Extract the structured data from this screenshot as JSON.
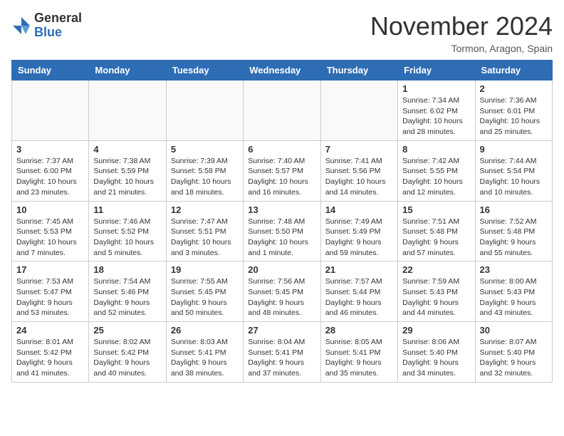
{
  "header": {
    "logo_general": "General",
    "logo_blue": "Blue",
    "month_year": "November 2024",
    "location": "Tormon, Aragon, Spain"
  },
  "weekdays": [
    "Sunday",
    "Monday",
    "Tuesday",
    "Wednesday",
    "Thursday",
    "Friday",
    "Saturday"
  ],
  "weeks": [
    [
      {
        "day": "",
        "detail": ""
      },
      {
        "day": "",
        "detail": ""
      },
      {
        "day": "",
        "detail": ""
      },
      {
        "day": "",
        "detail": ""
      },
      {
        "day": "",
        "detail": ""
      },
      {
        "day": "1",
        "detail": "Sunrise: 7:34 AM\nSunset: 6:02 PM\nDaylight: 10 hours and 28 minutes."
      },
      {
        "day": "2",
        "detail": "Sunrise: 7:36 AM\nSunset: 6:01 PM\nDaylight: 10 hours and 25 minutes."
      }
    ],
    [
      {
        "day": "3",
        "detail": "Sunrise: 7:37 AM\nSunset: 6:00 PM\nDaylight: 10 hours and 23 minutes."
      },
      {
        "day": "4",
        "detail": "Sunrise: 7:38 AM\nSunset: 5:59 PM\nDaylight: 10 hours and 21 minutes."
      },
      {
        "day": "5",
        "detail": "Sunrise: 7:39 AM\nSunset: 5:58 PM\nDaylight: 10 hours and 18 minutes."
      },
      {
        "day": "6",
        "detail": "Sunrise: 7:40 AM\nSunset: 5:57 PM\nDaylight: 10 hours and 16 minutes."
      },
      {
        "day": "7",
        "detail": "Sunrise: 7:41 AM\nSunset: 5:56 PM\nDaylight: 10 hours and 14 minutes."
      },
      {
        "day": "8",
        "detail": "Sunrise: 7:42 AM\nSunset: 5:55 PM\nDaylight: 10 hours and 12 minutes."
      },
      {
        "day": "9",
        "detail": "Sunrise: 7:44 AM\nSunset: 5:54 PM\nDaylight: 10 hours and 10 minutes."
      }
    ],
    [
      {
        "day": "10",
        "detail": "Sunrise: 7:45 AM\nSunset: 5:53 PM\nDaylight: 10 hours and 7 minutes."
      },
      {
        "day": "11",
        "detail": "Sunrise: 7:46 AM\nSunset: 5:52 PM\nDaylight: 10 hours and 5 minutes."
      },
      {
        "day": "12",
        "detail": "Sunrise: 7:47 AM\nSunset: 5:51 PM\nDaylight: 10 hours and 3 minutes."
      },
      {
        "day": "13",
        "detail": "Sunrise: 7:48 AM\nSunset: 5:50 PM\nDaylight: 10 hours and 1 minute."
      },
      {
        "day": "14",
        "detail": "Sunrise: 7:49 AM\nSunset: 5:49 PM\nDaylight: 9 hours and 59 minutes."
      },
      {
        "day": "15",
        "detail": "Sunrise: 7:51 AM\nSunset: 5:48 PM\nDaylight: 9 hours and 57 minutes."
      },
      {
        "day": "16",
        "detail": "Sunrise: 7:52 AM\nSunset: 5:48 PM\nDaylight: 9 hours and 55 minutes."
      }
    ],
    [
      {
        "day": "17",
        "detail": "Sunrise: 7:53 AM\nSunset: 5:47 PM\nDaylight: 9 hours and 53 minutes."
      },
      {
        "day": "18",
        "detail": "Sunrise: 7:54 AM\nSunset: 5:46 PM\nDaylight: 9 hours and 52 minutes."
      },
      {
        "day": "19",
        "detail": "Sunrise: 7:55 AM\nSunset: 5:45 PM\nDaylight: 9 hours and 50 minutes."
      },
      {
        "day": "20",
        "detail": "Sunrise: 7:56 AM\nSunset: 5:45 PM\nDaylight: 9 hours and 48 minutes."
      },
      {
        "day": "21",
        "detail": "Sunrise: 7:57 AM\nSunset: 5:44 PM\nDaylight: 9 hours and 46 minutes."
      },
      {
        "day": "22",
        "detail": "Sunrise: 7:59 AM\nSunset: 5:43 PM\nDaylight: 9 hours and 44 minutes."
      },
      {
        "day": "23",
        "detail": "Sunrise: 8:00 AM\nSunset: 5:43 PM\nDaylight: 9 hours and 43 minutes."
      }
    ],
    [
      {
        "day": "24",
        "detail": "Sunrise: 8:01 AM\nSunset: 5:42 PM\nDaylight: 9 hours and 41 minutes."
      },
      {
        "day": "25",
        "detail": "Sunrise: 8:02 AM\nSunset: 5:42 PM\nDaylight: 9 hours and 40 minutes."
      },
      {
        "day": "26",
        "detail": "Sunrise: 8:03 AM\nSunset: 5:41 PM\nDaylight: 9 hours and 38 minutes."
      },
      {
        "day": "27",
        "detail": "Sunrise: 8:04 AM\nSunset: 5:41 PM\nDaylight: 9 hours and 37 minutes."
      },
      {
        "day": "28",
        "detail": "Sunrise: 8:05 AM\nSunset: 5:41 PM\nDaylight: 9 hours and 35 minutes."
      },
      {
        "day": "29",
        "detail": "Sunrise: 8:06 AM\nSunset: 5:40 PM\nDaylight: 9 hours and 34 minutes."
      },
      {
        "day": "30",
        "detail": "Sunrise: 8:07 AM\nSunset: 5:40 PM\nDaylight: 9 hours and 32 minutes."
      }
    ]
  ]
}
